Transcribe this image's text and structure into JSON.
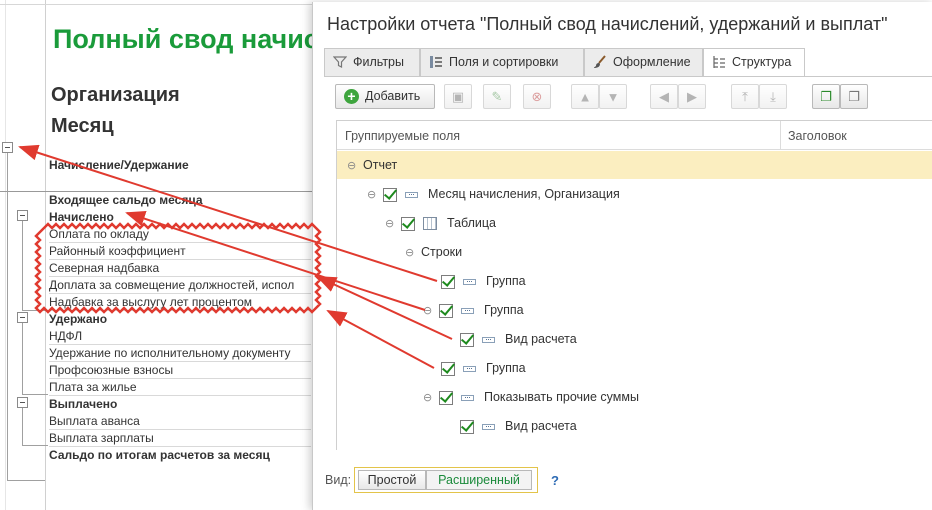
{
  "report": {
    "title": "Полный свод начис",
    "params": [
      "Организация",
      "Месяц"
    ],
    "column_header": "Начисление/Удержание",
    "rows": [
      {
        "text": "Входящее сальдо месяца",
        "bold": true
      },
      {
        "text": "Начислено",
        "bold": true
      },
      {
        "text": "Оплата по окладу",
        "bold": false
      },
      {
        "text": "Районный коэффициент",
        "bold": false
      },
      {
        "text": "Северная надбавка",
        "bold": false
      },
      {
        "text": "Доплата за совмещение должностей, испол",
        "bold": false
      },
      {
        "text": "Надбавка за выслугу лет процентом",
        "bold": false
      },
      {
        "text": "Удержано",
        "bold": true
      },
      {
        "text": "НДФЛ",
        "bold": false
      },
      {
        "text": "Удержание по исполнительному документу",
        "bold": false
      },
      {
        "text": "Профсоюзные взносы",
        "bold": false
      },
      {
        "text": "Плата за жилье",
        "bold": false
      },
      {
        "text": "Выплачено",
        "bold": true
      },
      {
        "text": "Выплата аванса",
        "bold": false
      },
      {
        "text": "Выплата зарплаты",
        "bold": false
      },
      {
        "text": "Сальдо по итогам расчетов за месяц",
        "bold": true
      }
    ]
  },
  "dialog": {
    "title": "Настройки отчета \"Полный свод начислений, удержаний и выплат\"",
    "tabs": [
      {
        "label": "Фильтры",
        "icon": "filter-icon",
        "active": false
      },
      {
        "label": "Поля и сортировки",
        "icon": "fields-icon",
        "active": false
      },
      {
        "label": "Оформление",
        "icon": "brush-icon",
        "active": false
      },
      {
        "label": "Структура",
        "icon": "structure-icon",
        "active": true
      }
    ],
    "toolbar": {
      "add_label": "Добавить"
    },
    "tree": {
      "col_fields": "Группируемые поля",
      "col_title": "Заголовок",
      "nodes": [
        {
          "label": "Отчет",
          "checkbox": false,
          "icon": "none",
          "selected": true
        },
        {
          "label": "Месяц начисления, Организация",
          "checkbox": true,
          "icon": "field-icon"
        },
        {
          "label": "Таблица",
          "checkbox": true,
          "icon": "table-icon"
        },
        {
          "label": "Строки",
          "checkbox": false,
          "icon": "none"
        },
        {
          "label": "Группа",
          "checkbox": true,
          "icon": "field-icon"
        },
        {
          "label": "Группа",
          "checkbox": true,
          "icon": "field-icon"
        },
        {
          "label": "Вид расчета",
          "checkbox": true,
          "icon": "field-icon"
        },
        {
          "label": "Группа",
          "checkbox": true,
          "icon": "field-icon"
        },
        {
          "label": "Показывать прочие суммы",
          "checkbox": true,
          "icon": "field-icon"
        },
        {
          "label": "Вид расчета",
          "checkbox": true,
          "icon": "field-icon"
        }
      ]
    },
    "view": {
      "label": "Вид:",
      "simple": "Простой",
      "extended": "Расширенный",
      "help": "?"
    }
  },
  "colors": {
    "title_green": "#1a9b3a",
    "annotation_red": "#e03a2f",
    "selection_yellow": "#fbeec0",
    "check_green": "#1e8a1e"
  }
}
